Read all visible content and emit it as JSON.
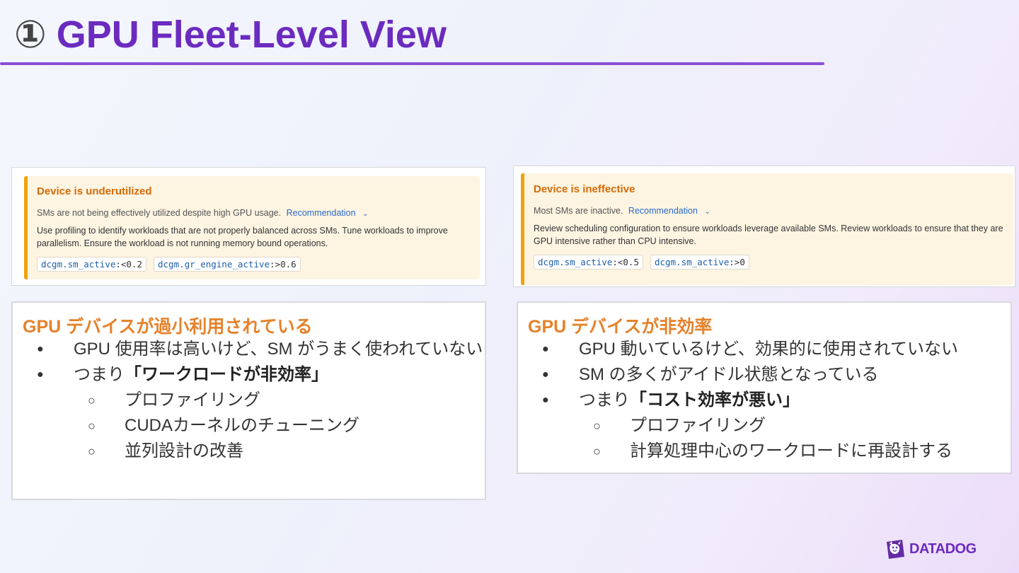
{
  "slide": {
    "number": "①",
    "title": "GPU Fleet-Level View"
  },
  "left_panel": {
    "alert_title": "Device is underutilized",
    "subtitle": "SMs are not being effectively utilized despite high GPU usage.",
    "recommendation_label": "Recommendation",
    "body": "Use profiling to identify workloads that are not properly balanced across SMs. Tune workloads to improve parallelism. Ensure the workload is not running memory bound operations.",
    "tags": [
      {
        "key": "dcgm.sm_active",
        "value": ":<0.2"
      },
      {
        "key": "dcgm.gr_engine_active",
        "value": ":>0.6"
      }
    ]
  },
  "right_panel": {
    "alert_title": "Device is ineffective",
    "subtitle": "Most SMs are inactive.",
    "recommendation_label": "Recommendation",
    "body": "Review scheduling configuration to ensure workloads leverage available SMs. Review workloads to ensure that they are GPU intensive rather than CPU intensive.",
    "tags": [
      {
        "key": "dcgm.sm_active",
        "value": ":<0.5"
      },
      {
        "key": "dcgm.sm_active",
        "value": ":>0"
      }
    ]
  },
  "left_box": {
    "heading": "GPU デバイスが過小利用されている",
    "bullet1": "GPU 使用率は高いけど、SM がうまく使われていない",
    "bullet2_prefix": "つまり",
    "bullet2_bold": "「ワークロードが非効率」",
    "sub1": "プロファイリング",
    "sub2": "CUDAカーネルのチューニング",
    "sub3": "並列設計の改善"
  },
  "right_box": {
    "heading": "GPU デバイスが非効率",
    "bullet1": "GPU 動いているけど、効果的に使用されていない",
    "bullet2": "SM の多くがアイドル状態となっている",
    "bullet3_prefix": "つまり",
    "bullet3_bold": "「コスト効率が悪い」",
    "sub1": "プロファイリング",
    "sub2": "計算処理中心のワークロードに再設計する"
  },
  "logo": {
    "text": "DATADOG",
    "color": "#632ca6"
  }
}
